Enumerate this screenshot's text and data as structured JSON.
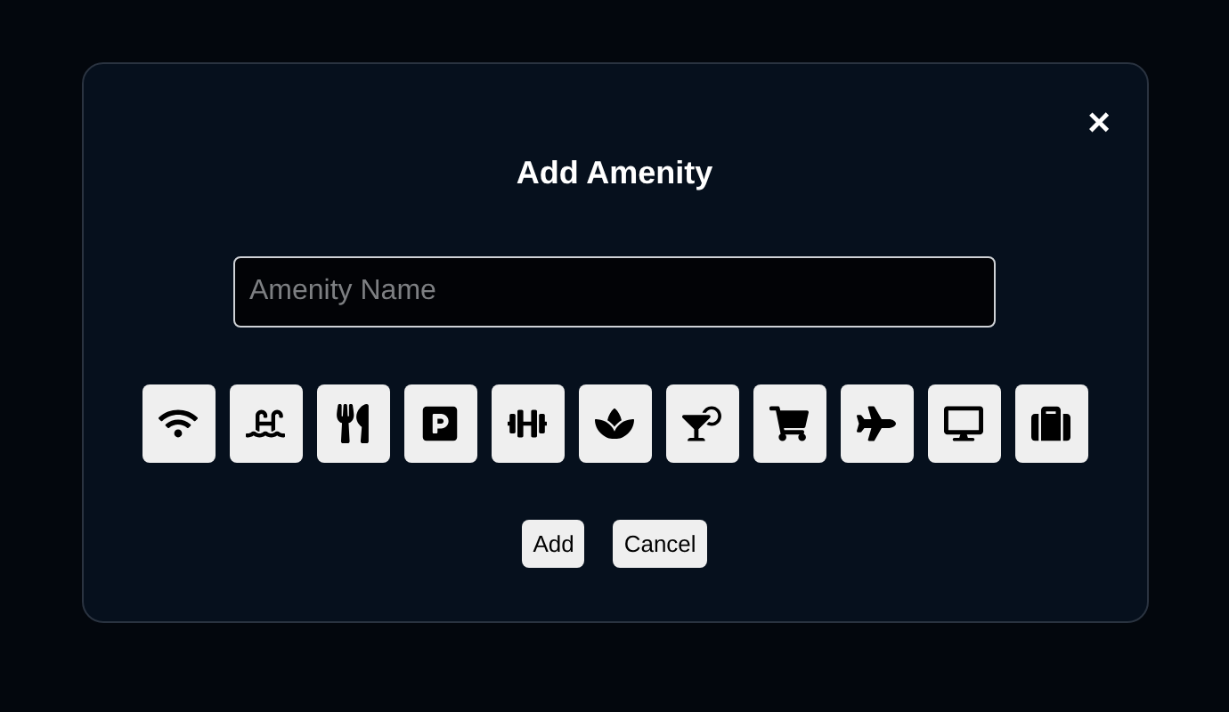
{
  "dialog": {
    "title": "Add Amenity",
    "close": "×",
    "name_field": {
      "placeholder": "Amenity Name"
    },
    "icons": [
      {
        "kind": "wifi"
      },
      {
        "kind": "pool"
      },
      {
        "kind": "restaurant"
      },
      {
        "kind": "parking"
      },
      {
        "kind": "gym"
      },
      {
        "kind": "spa"
      },
      {
        "kind": "bar"
      },
      {
        "kind": "shopping"
      },
      {
        "kind": "airport"
      },
      {
        "kind": "tv"
      },
      {
        "kind": "luggage"
      }
    ],
    "buttons": [
      "Add",
      "Cancel"
    ]
  }
}
